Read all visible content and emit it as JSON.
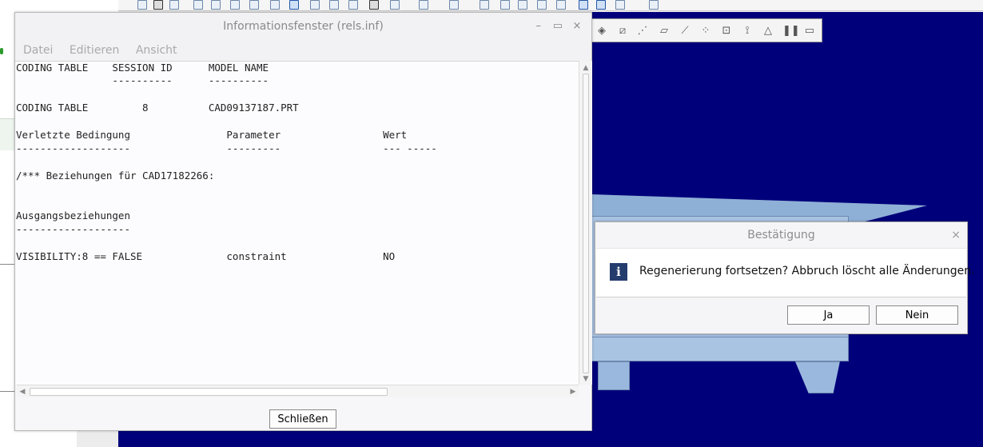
{
  "info_window": {
    "title": "Informationsfenster (rels.inf)",
    "controls": {
      "minimize": "–",
      "maximize": "▭",
      "close": "×"
    },
    "menu": [
      "Datei",
      "Editieren",
      "Ansicht"
    ],
    "lines": [
      "CODING TABLE    SESSION ID      MODEL NAME",
      "                ----------      ----------",
      "",
      "CODING TABLE         8          CAD09137187.PRT",
      "",
      "Verletzte Bedingung                Parameter                 Wert",
      "-------------------                ---------                 --- -----",
      "",
      "/*** Beziehungen für CAD17182266:",
      "",
      "",
      "Ausgangsbeziehungen",
      "-------------------",
      "",
      "VISIBILITY:8 == FALSE              constraint                NO"
    ],
    "close_button": "Schließen"
  },
  "confirm_dialog": {
    "title": "Bestätigung",
    "close": "×",
    "icon": "info-icon",
    "icon_glyph": "i",
    "message": "Regenerierung fortsetzen? Abbruch löscht alle Änderungen.",
    "buttons": {
      "yes": "Ja",
      "no": "Nein"
    }
  },
  "colors": {
    "viewport_bg": "#00007a",
    "model": "#a9c3e3",
    "info_icon_bg": "#243b6d"
  }
}
